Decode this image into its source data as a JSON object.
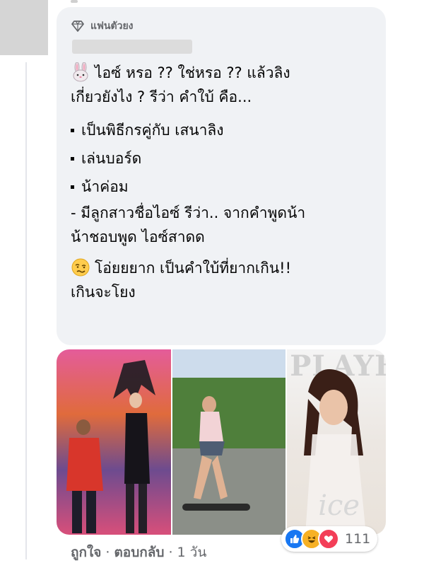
{
  "comment": {
    "badge_label": "แฟนตัวยง",
    "badge_icon": "diamond-icon",
    "lines": {
      "l1": "ไอซ์ หรอ ?? ใช่หรอ ?? แล้วลิง",
      "l2": "เกี่ยวยังไง ? รีว่า คำใบ้ คือ...",
      "b1": "เป็นพิธีกรคู่กับ เสนาลิง",
      "b2": "เล่นบอร์ด",
      "b3": "น้าค่อม",
      "l3": "- มีลูกสาวชื่อไอซ์ รีว่า.. จากคำพูดน้า",
      "l4": "น้าชอบพูด ไอซ์สาดด",
      "l5": "โอ่ยยยาก เป็นคำใบ้ที่ยากเกิน!!",
      "l6": "เกินจะโยง"
    },
    "emoji_first": "rabbit-face-emoji",
    "emoji_second": "woozy-face-emoji"
  },
  "photos": {
    "watermark_brand": "PLAYBOY",
    "watermark_name": "ice"
  },
  "reactions": {
    "icons": [
      "like-icon",
      "haha-icon",
      "love-icon"
    ],
    "count": "111",
    "colors": {
      "like": "#1877f2",
      "haha": "#f7b125",
      "love": "#f33e58"
    }
  },
  "actions": {
    "like_label": "ถูกใจ",
    "reply_label": "ตอบกลับ",
    "time_label": "1 วัน",
    "separator": "·"
  }
}
